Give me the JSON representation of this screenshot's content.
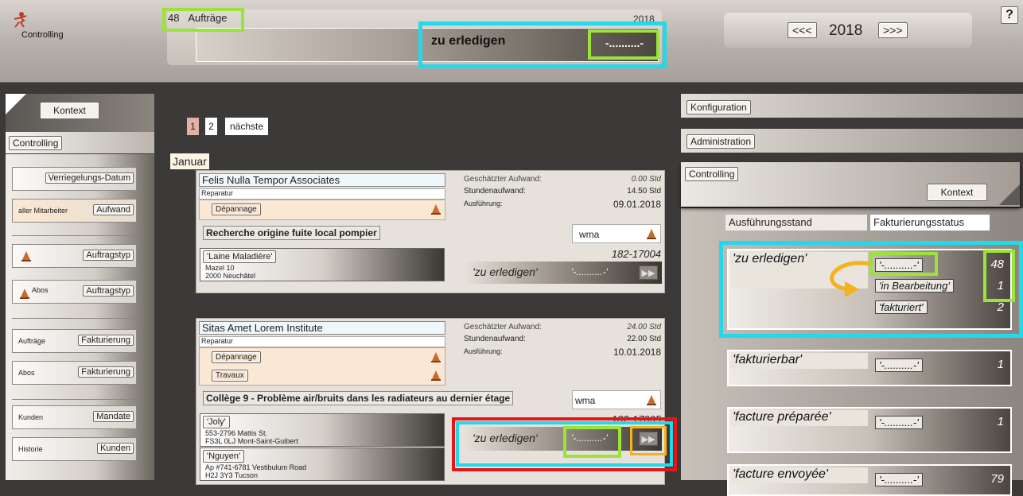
{
  "app": {
    "name": "Controlling",
    "help": "?"
  },
  "header": {
    "count": "48",
    "count_label": "Aufträge",
    "year_small": "2018",
    "status_label": "zu erledigen",
    "status_value": "-..........-",
    "nav_prev": "<<<",
    "nav_year": "2018",
    "nav_next": ">>>"
  },
  "sidebar": {
    "kontext": "Kontext",
    "section": "Controlling",
    "items": [
      {
        "label": "",
        "button": "Verriegelungs-Datum"
      },
      {
        "label": "aller Mitarbeiter",
        "button": "Aufwand"
      },
      {
        "label": "",
        "button": "Auftragstyp",
        "icon": "cone-icon"
      },
      {
        "label": "Abos",
        "button": "Auftragstyp",
        "icon": "cone-icon"
      },
      {
        "label": "Aufträge",
        "button": "Fakturierung"
      },
      {
        "label": "Abos",
        "button": "Fakturierung"
      },
      {
        "label": "Kunden",
        "button": "Mandate"
      },
      {
        "label": "Historie",
        "button": "Kunden"
      }
    ]
  },
  "pagination": {
    "pages": [
      "1",
      "2"
    ],
    "next": "nächste"
  },
  "month": "Januar",
  "orders": [
    {
      "company": "Felis Nulla Tempor Associates",
      "type": "Reparatur",
      "tags": [
        "Dépannage"
      ],
      "aufwand_label": "Geschätzter Aufwand:",
      "aufwand": "0.00 Std",
      "stunden_label": "Stundenaufwand:",
      "stunden": "14.50 Std",
      "ausf_label": "Ausführung:",
      "ausf": "09.01.2018",
      "title": "Recherche origine fuite local pompier",
      "user": "wma",
      "contacts": [
        {
          "name": "'Laine Maladière'",
          "line1": "Mazel 10",
          "line2": "2000 Neuchâtel"
        }
      ],
      "number": "182-17004",
      "status": "'zu erledigen'",
      "status_value": "'-..........-'",
      "go": "▶▶"
    },
    {
      "company": "Sitas Amet Lorem Institute",
      "type": "Reparatur",
      "tags": [
        "Dépannage",
        "Travaux"
      ],
      "aufwand_label": "Geschätzter Aufwand:",
      "aufwand": "24.00 Std",
      "stunden_label": "Stundenaufwand:",
      "stunden": "22.00 Std",
      "ausf_label": "Ausführung:",
      "ausf": "10.01.2018",
      "title": "Collège 9 - Problème air/bruits dans les radiateurs au dernier étage",
      "user": "wma",
      "contacts": [
        {
          "name": "'Joly'",
          "line1": "553-2796 Mattis St.",
          "line2": "FS3L 0LJ Mont-Saint-Guibert"
        },
        {
          "name": "'Nguyen'",
          "line1": "Ap #741-6781 Vestibulum Road",
          "line2": "H2J 3Y3 Tucson"
        }
      ],
      "number": "182-17005",
      "status": "'zu erledigen'",
      "status_value": "'-..........-'",
      "go": "▶▶"
    }
  ],
  "right": {
    "konfiguration": "Konfiguration",
    "administration": "Administration",
    "controlling": "Controlling",
    "kontext": "Kontext",
    "col1": "Ausführungsstand",
    "col2": "Fakturierungsstatus",
    "groups": [
      {
        "title": "'zu erledigen'",
        "rows": [
          {
            "label": "'-..........-'",
            "count": "48"
          },
          {
            "label": "'in Bearbeitung'",
            "count": "1"
          },
          {
            "label": "'fakturiert'",
            "count": "2"
          }
        ]
      },
      {
        "title": "'fakturierbar'",
        "rows": [
          {
            "label": "'-..........-'",
            "count": "1"
          }
        ]
      },
      {
        "title": "'facture préparée'",
        "rows": [
          {
            "label": "'-..........-'",
            "count": "1"
          }
        ]
      },
      {
        "title": "'facture envoyée'",
        "rows": [
          {
            "label": "'-..........-'",
            "count": "79"
          }
        ]
      }
    ]
  }
}
